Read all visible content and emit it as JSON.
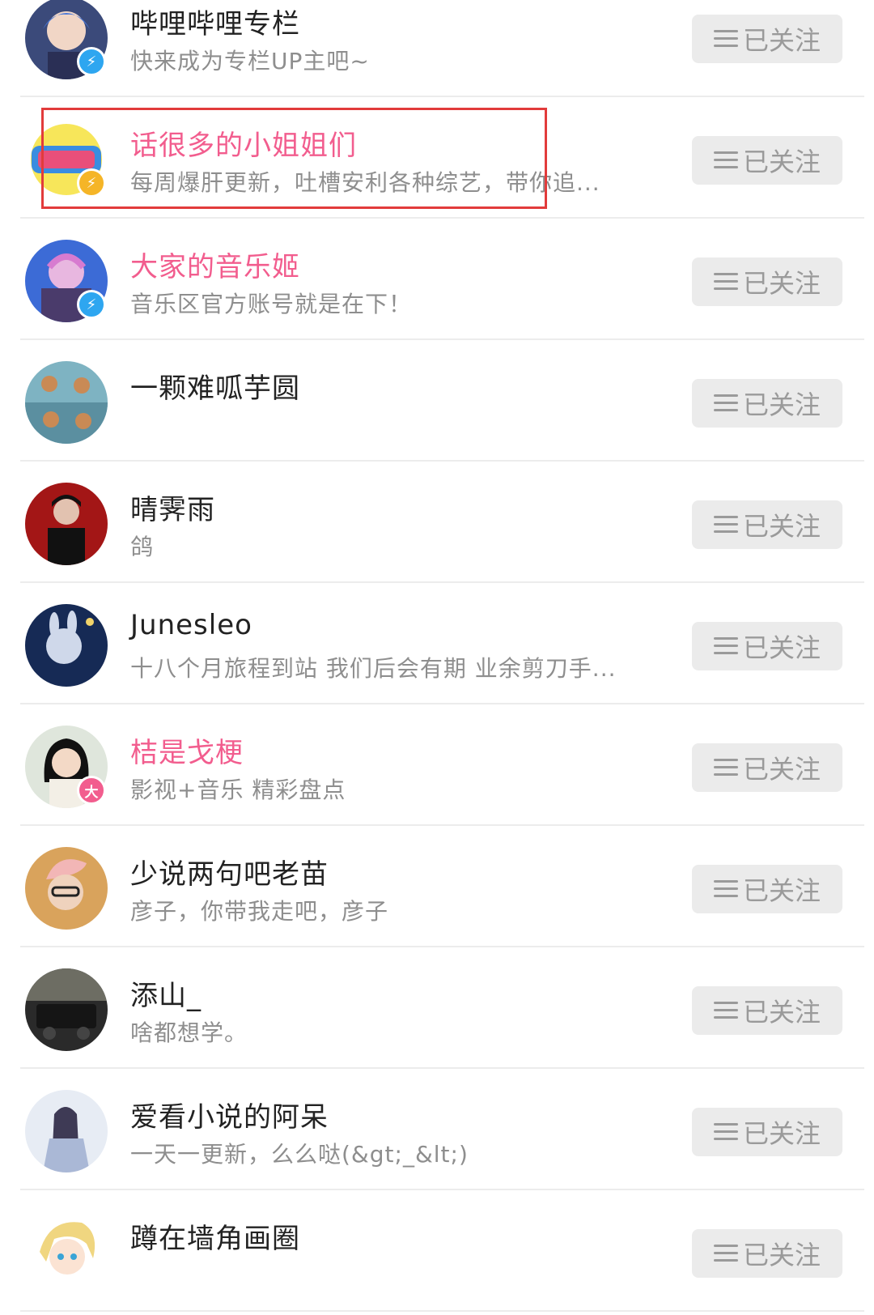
{
  "follow_list": [
    {
      "name": "哔哩哔哩专栏",
      "desc": "快来成为专栏UP主吧~",
      "name_color": "normal",
      "badge": "blue",
      "badge_icon": "lightning-icon",
      "button": "已关注"
    },
    {
      "name": "话很多的小姐姐们",
      "desc": "每周爆肝更新，吐槽安利各种综艺，带你追...",
      "name_color": "pink",
      "badge": "yellow",
      "badge_icon": "lightning-icon",
      "button": "已关注"
    },
    {
      "name": "大家的音乐姬",
      "desc": "音乐区官方账号就是在下！",
      "name_color": "pink",
      "badge": "blue",
      "badge_icon": "lightning-icon",
      "button": "已关注"
    },
    {
      "name": "一颗难呱芋圆",
      "desc": "",
      "name_color": "normal",
      "badge": "",
      "button": "已关注"
    },
    {
      "name": "晴霁雨",
      "desc": "鸽",
      "name_color": "normal",
      "badge": "",
      "button": "已关注"
    },
    {
      "name": "Junesleo",
      "desc": "十八个月旅程到站 我们后会有期 业余剪刀手...",
      "name_color": "normal",
      "badge": "",
      "button": "已关注"
    },
    {
      "name": "桔是戈梗",
      "desc": "影视+音乐 精彩盘点",
      "name_color": "pink",
      "badge": "pink",
      "badge_icon": "big-member-icon",
      "badge_text": "大",
      "button": "已关注"
    },
    {
      "name": "少说两句吧老苗",
      "desc": "彦子，你带我走吧，彦子",
      "name_color": "normal",
      "badge": "",
      "button": "已关注"
    },
    {
      "name": "添山_",
      "desc": "啥都想学。",
      "name_color": "normal",
      "badge": "",
      "button": "已关注"
    },
    {
      "name": "爱看小说的阿呆",
      "desc": "一天一更新，么么哒(&gt;_&lt;)",
      "name_color": "normal",
      "badge": "",
      "button": "已关注"
    },
    {
      "name": "蹲在墙角画圈",
      "desc": "",
      "name_color": "normal",
      "badge": "",
      "button": "已关注"
    }
  ],
  "colors": {
    "pink_name": "#f25d8e",
    "highlight_box": "#e23b3b",
    "button_bg": "#ebebeb",
    "button_text": "#9a9a9a",
    "badge_blue": "#2ea6f0",
    "badge_yellow": "#f5b527"
  }
}
